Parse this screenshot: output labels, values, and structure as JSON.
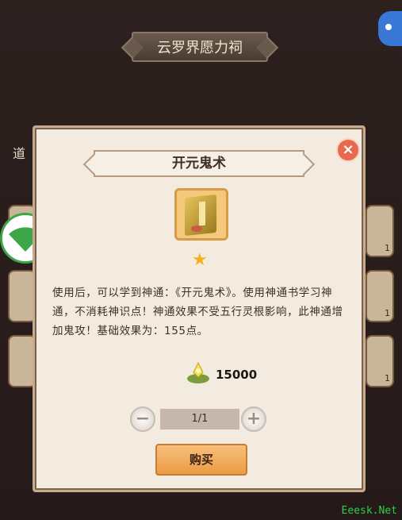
{
  "header": {
    "title": "云罗界愿力祠"
  },
  "side": {
    "label": "道",
    "qty": "1"
  },
  "dialog": {
    "title": "开元鬼术",
    "close": "×",
    "description": "使用后，可以学到神通：《开元鬼术》。使用神通书学习神通，不消耗神识点！神通效果不受五行灵根影响，此神通增加鬼攻！基础效果为：155点。",
    "price": "15000",
    "quantity": "1/1",
    "minus": "−",
    "plus": "+",
    "buy_label": "购买"
  },
  "watermark": "Eeesk.Net",
  "colors": {
    "accent": "#ec9a45",
    "close": "#e66a4f"
  }
}
